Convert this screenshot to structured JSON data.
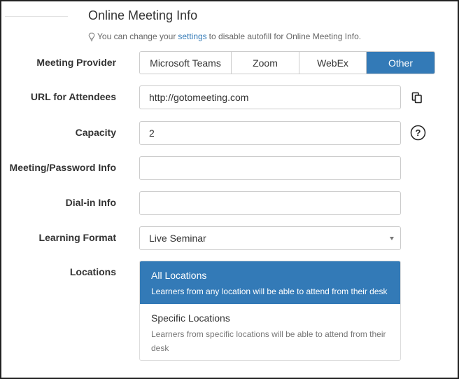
{
  "section": {
    "title": "Online Meeting Info",
    "hint_prefix": "You can change your",
    "hint_link": "settings",
    "hint_suffix": "to disable autofill for Online Meeting Info."
  },
  "labels": {
    "provider": "Meeting Provider",
    "url": "URL for Attendees",
    "capacity": "Capacity",
    "password": "Meeting/Password Info",
    "dialin": "Dial-in Info",
    "format": "Learning Format",
    "locations": "Locations"
  },
  "provider": {
    "options": [
      "Microsoft Teams",
      "Zoom",
      "WebEx",
      "Other"
    ],
    "selected": "Other"
  },
  "fields": {
    "url_value": "http://gotomeeting.com",
    "capacity_value": "2",
    "password_value": "",
    "dialin_value": "",
    "format_value": "Live Seminar"
  },
  "locations": {
    "all_title": "All Locations",
    "all_desc": "Learners from any location will be able to attend from their desk",
    "specific_title": "Specific Locations",
    "specific_desc": "Learners from specific locations will be able to attend from their desk",
    "selected": "All Locations"
  },
  "colors": {
    "accent": "#337ab7",
    "border": "#cccccc"
  },
  "icons": {
    "hint": "lightbulb-icon",
    "copy": "copy-icon",
    "help": "question-circle-icon",
    "dropdown": "caret-down-icon"
  }
}
